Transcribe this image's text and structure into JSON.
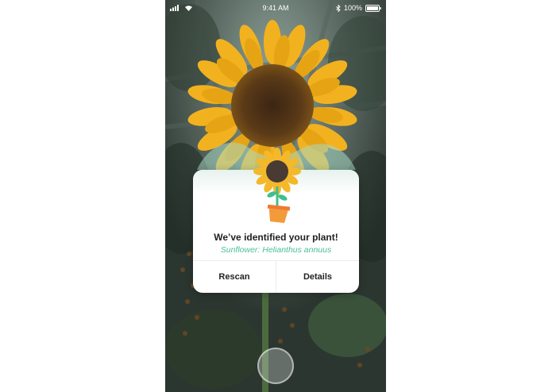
{
  "status_bar": {
    "time": "9:41 AM",
    "battery": "100%",
    "icons": [
      "signal-icon",
      "wifi-icon",
      "bluetooth-icon",
      "battery-icon"
    ]
  },
  "result_card": {
    "title": "We’ve identified your plant!",
    "subtitle": "Sunflower: Helianthus annuus",
    "rescan_label": "Rescan",
    "details_label": "Details"
  },
  "colors": {
    "accent": "#4cbf94",
    "petal": "#f4b82a",
    "pot": "#f07a2e"
  }
}
